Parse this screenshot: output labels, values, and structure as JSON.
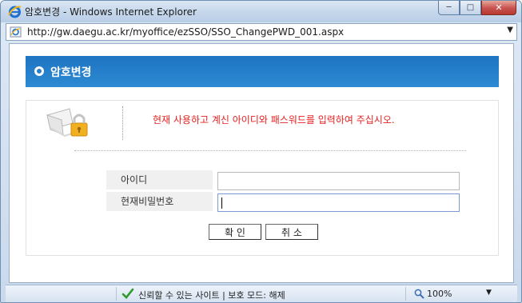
{
  "window": {
    "title": "암호변경 - Windows Internet Explorer",
    "minimize_icon": "minimize-icon",
    "maximize_icon": "maximize-icon",
    "close_icon": "close-icon"
  },
  "address_bar": {
    "url": "http://gw.daegu.ac.kr/myoffice/ezSSO/SSO_ChangePWD_001.aspx"
  },
  "page": {
    "header_title": "암호변경",
    "notice": "현재 사용하고 계신 아이디와 패스워드를 입력하여 주십시오.",
    "form": {
      "id_label": "아이디",
      "id_value": "",
      "password_label": "현재비밀번호",
      "password_value": ""
    },
    "buttons": {
      "confirm": "확 인",
      "cancel": "취 소"
    }
  },
  "status_bar": {
    "security_text": "신뢰할 수 있는 사이트 | 보호 모드: 해제",
    "zoom": "100%"
  },
  "colors": {
    "header_blue": "#1e74c1",
    "notice_red": "#e52020"
  }
}
